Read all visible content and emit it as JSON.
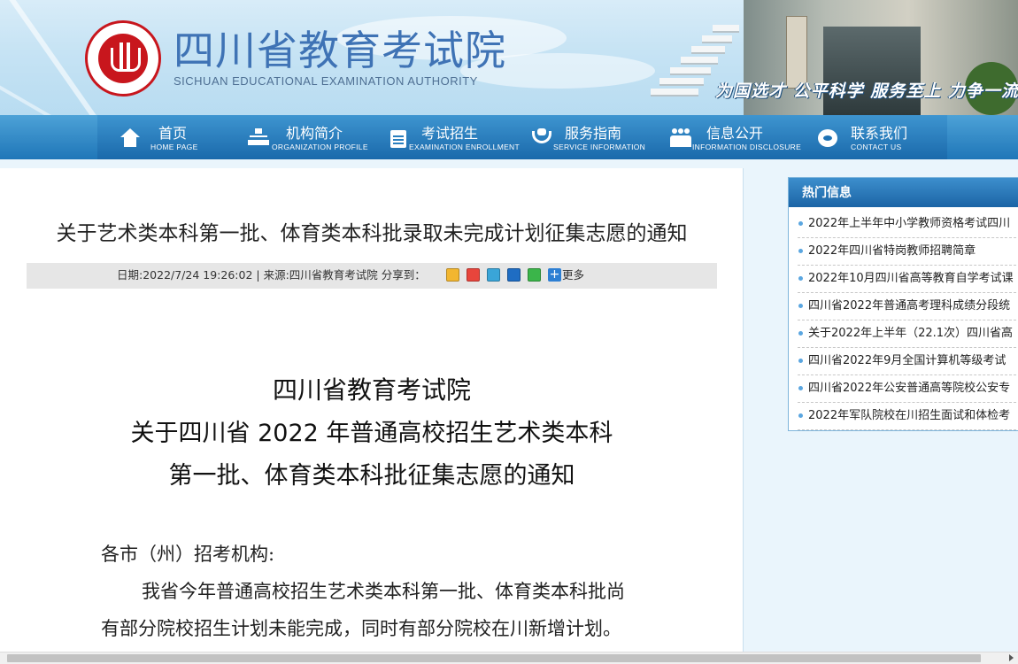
{
  "header": {
    "logo_cn": "四川省教育考试院",
    "logo_en": "SICHUAN EDUCATIONAL EXAMINATION AUTHORITY",
    "slogan": "为国选才 公平科学 服务至上 力争一流"
  },
  "nav": [
    {
      "cn": "首页",
      "en": "HOME  PAGE",
      "icon": "home-icon"
    },
    {
      "cn": "机构简介",
      "en": "ORGANIZATION PROFILE",
      "icon": "organization-icon"
    },
    {
      "cn": "考试招生",
      "en": "EXAMINATION ENROLLMENT",
      "icon": "exam-icon"
    },
    {
      "cn": "服务指南",
      "en": "SERVICE  INFORMATION",
      "icon": "handshake-icon"
    },
    {
      "cn": "信息公开",
      "en": "INFORMATION  DISCLOSURE",
      "icon": "people-icon"
    },
    {
      "cn": "联系我们",
      "en": "CONTACT  US",
      "icon": "phone-icon"
    }
  ],
  "article": {
    "title": "关于艺术类本科第一批、体育类本科批录取未完成计划征集志愿的通知",
    "meta": "日期:2022/7/24 19:26:02 | 来源:四川省教育考试院   分享到：",
    "share_more": "更多",
    "share_icons": [
      {
        "name": "qzone-share-icon",
        "color": "#f2b630"
      },
      {
        "name": "weibo-share-icon",
        "color": "#e8453c"
      },
      {
        "name": "tencent-weibo-share-icon",
        "color": "#3aa5d8"
      },
      {
        "name": "renren-share-icon",
        "color": "#1f6dc3"
      },
      {
        "name": "wechat-share-icon",
        "color": "#3bb54a"
      }
    ],
    "doc_org": "四川省教育考试院",
    "doc_title_line1": "关于四川省 2022 年普通高校招生艺术类本科",
    "doc_title_line2": "第一批、体育类本科批征集志愿的通知",
    "salutation": "各市（州）招考机构:",
    "para1_line1": "我省今年普通高校招生艺术类本科第一批、体育类本科批尚",
    "para1_line2": "有部分院校招生计划未能完成，同时有部分院校在川新增计划。"
  },
  "sidebar": {
    "title": "热门信息",
    "items": [
      "2022年上半年中小学教师资格考试四川",
      "2022年四川省特岗教师招聘简章",
      "2022年10月四川省高等教育自学考试课",
      "四川省2022年普通高考理科成绩分段统",
      "关于2022年上半年（22.1次）四川省高",
      "四川省2022年9月全国计算机等级考试",
      "四川省2022年公安普通高等院校公安专",
      "2022年军队院校在川招生面试和体检考"
    ]
  },
  "colors": {
    "nav_blue": "#1f76b8",
    "logo_red": "#c8161d",
    "logo_blue": "#3f73b5",
    "sidebar_head": "#1b64a5"
  }
}
